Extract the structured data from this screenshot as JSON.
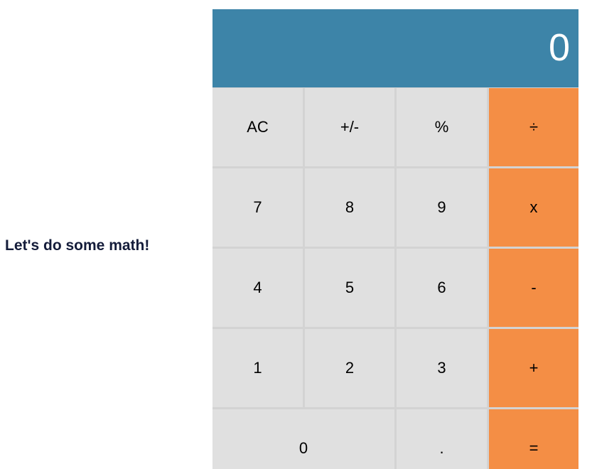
{
  "tagline": "Let's do some math!",
  "display": {
    "value": "0"
  },
  "keys": {
    "ac": "AC",
    "sign": "+/-",
    "percent": "%",
    "divide": "÷",
    "seven": "7",
    "eight": "8",
    "nine": "9",
    "multiply": "x",
    "four": "4",
    "five": "5",
    "six": "6",
    "minus": "-",
    "one": "1",
    "two": "2",
    "three": "3",
    "plus": "+",
    "zero": "0",
    "decimal": ".",
    "equals": "="
  },
  "colors": {
    "display_background": "#3d84a8",
    "operator_key": "#f48e45",
    "number_key": "#e0e0e0",
    "key_gap": "#d3d3d3",
    "tagline_text": "#141c3a"
  }
}
